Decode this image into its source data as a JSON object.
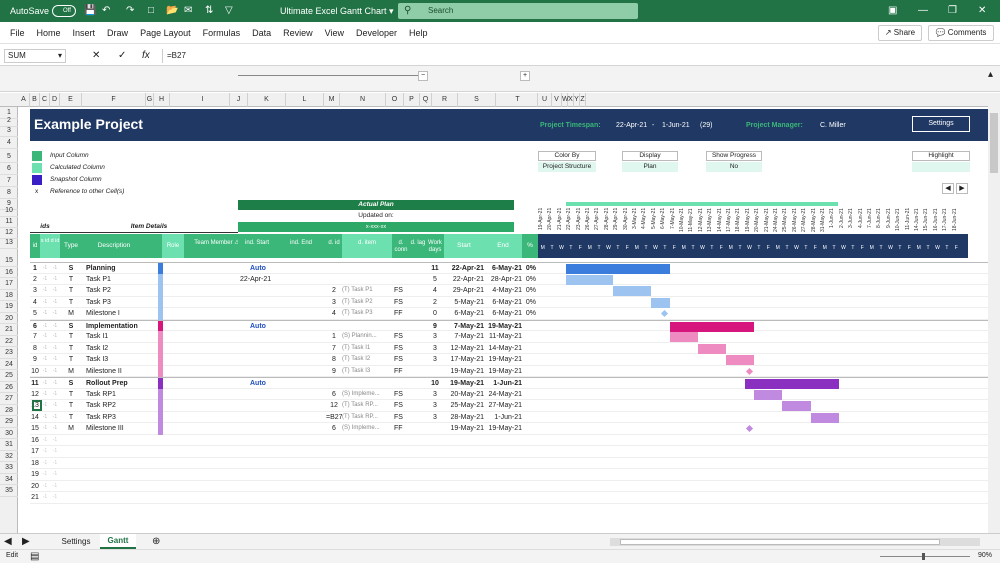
{
  "titlebar": {
    "autosave": "AutoSave",
    "autosave_state": "Off",
    "doc_title": "Ultimate Excel Gantt Chart",
    "search_placeholder": "Search"
  },
  "menu": [
    "File",
    "Home",
    "Insert",
    "Draw",
    "Page Layout",
    "Formulas",
    "Data",
    "Review",
    "View",
    "Developer",
    "Help"
  ],
  "share": "Share",
  "comments": "Comments",
  "formula": {
    "namebox": "SUM",
    "content": "=B27"
  },
  "columns": [
    "A",
    "B",
    "C",
    "D",
    "E",
    "F",
    "G",
    "H",
    "I",
    "J",
    "K",
    "L",
    "M",
    "N",
    "O",
    "P",
    "Q",
    "R",
    "S",
    "T",
    "U",
    "V",
    "W",
    "X",
    "Y",
    "Z"
  ],
  "header": {
    "project_title": "Example Project",
    "timespan_label": "Project Timespan:",
    "timespan_start": "22-Apr-21",
    "timespan_sep": "-",
    "timespan_end": "1-Jun-21",
    "timespan_days": "(29)",
    "pm_label": "Project Manager:",
    "pm_name": "C. Miller",
    "settings": "Settings"
  },
  "legend": [
    {
      "label": "Input Column",
      "color": "#3ab779"
    },
    {
      "label": "Calculated Column",
      "color": "#6de0b0"
    },
    {
      "label": "Snapshot Column",
      "color": "#3a1fc6"
    },
    {
      "label": "Reference to other Cell(s)",
      "symbol": "x"
    }
  ],
  "options": {
    "color_by_label": "Color By",
    "color_by_value": "Project Structure",
    "display_label": "Display",
    "display_value": "Plan",
    "progress_label": "Show Progress",
    "progress_value": "No",
    "highlight_label": "Highlight"
  },
  "table_headers": {
    "actual_plan": "Actual Plan",
    "updated_on": "Updated on:",
    "updated_val": "x-xxx-xx",
    "ids": "ids",
    "item_details": "Item Details",
    "id": "id",
    "s_id": "s id",
    "d_id": "d id",
    "type": "Type",
    "description": "Description",
    "role": "Role",
    "team_member": "Team Member",
    "ind_start": "ind. Start",
    "ind_end": "ind. End",
    "d_id2": "d. id",
    "d_item": "d. item",
    "d_conn": "d. conn",
    "d_lag": "d. lag",
    "work_days": "Work days",
    "start": "Start",
    "end": "End",
    "pct": "%"
  },
  "gantt_dates": [
    "19-Apr-21",
    "20-Apr-21",
    "21-Apr-21",
    "22-Apr-21",
    "23-Apr-21",
    "26-Apr-21",
    "27-Apr-21",
    "28-Apr-21",
    "29-Apr-21",
    "30-Apr-21",
    "3-May-21",
    "4-May-21",
    "5-May-21",
    "6-May-21",
    "7-May-21",
    "10-May-21",
    "11-May-21",
    "12-May-21",
    "13-May-21",
    "14-May-21",
    "17-May-21",
    "18-May-21",
    "19-May-21",
    "20-May-21",
    "21-May-21",
    "24-May-21",
    "25-May-21",
    "26-May-21",
    "27-May-21",
    "28-May-21",
    "31-May-21",
    "1-Jun-21",
    "2-Jun-21",
    "3-Jun-21",
    "4-Jun-21",
    "7-Jun-21",
    "8-Jun-21",
    "9-Jun-21",
    "10-Jun-21",
    "11-Jun-21",
    "14-Jun-21",
    "15-Jun-21",
    "16-Jun-21",
    "17-Jun-21",
    "18-Jun-21"
  ],
  "gantt_days": [
    "M",
    "T",
    "W",
    "T",
    "F"
  ],
  "rows": [
    {
      "n": "15",
      "id": "1",
      "type": "S",
      "desc": "Planning",
      "start_note": "Auto",
      "wd": "11",
      "start": "22-Apr-21",
      "end": "6-May-21",
      "pct": "0%",
      "bold": true,
      "color": "#3b7ddd"
    },
    {
      "n": "16",
      "id": "2",
      "type": "T",
      "desc": "Task P1",
      "ind_start": "22-Apr-21",
      "wd": "5",
      "start": "22-Apr-21",
      "end": "28-Apr-21",
      "pct": "0%",
      "color": "#9dc3f0"
    },
    {
      "n": "17",
      "id": "3",
      "type": "T",
      "desc": "Task P2",
      "did": "2",
      "ditem": "(T) Task P1",
      "dconn": "FS",
      "wd": "4",
      "start": "29-Apr-21",
      "end": "4-May-21",
      "pct": "0%",
      "color": "#9dc3f0"
    },
    {
      "n": "18",
      "id": "4",
      "type": "T",
      "desc": "Task P3",
      "did": "3",
      "ditem": "(T) Task P2",
      "dconn": "FS",
      "wd": "2",
      "start": "5-May-21",
      "end": "6-May-21",
      "pct": "0%",
      "color": "#9dc3f0"
    },
    {
      "n": "19",
      "id": "5",
      "type": "M",
      "desc": "Milestone I",
      "did": "4",
      "ditem": "(T) Task P3",
      "dconn": "FF",
      "wd": "0",
      "start": "6-May-21",
      "end": "6-May-21",
      "pct": "0%",
      "color": "#9dc3f0"
    },
    {
      "n": "20",
      "id": "6",
      "type": "S",
      "desc": "Implementation",
      "start_note": "Auto",
      "wd": "9",
      "start": "7-May-21",
      "end": "19-May-21",
      "bold": true,
      "color": "#d6157d"
    },
    {
      "n": "21",
      "id": "7",
      "type": "T",
      "desc": "Task I1",
      "did": "1",
      "ditem": "(S) Plannin...",
      "dconn": "FS",
      "wd": "3",
      "start": "7-May-21",
      "end": "11-May-21",
      "color": "#ee8bc0"
    },
    {
      "n": "22",
      "id": "8",
      "type": "T",
      "desc": "Task I2",
      "did": "7",
      "ditem": "(T) Task I1",
      "dconn": "FS",
      "wd": "3",
      "start": "12-May-21",
      "end": "14-May-21",
      "color": "#ee8bc0"
    },
    {
      "n": "23",
      "id": "9",
      "type": "T",
      "desc": "Task I3",
      "did": "8",
      "ditem": "(T) Task I2",
      "dconn": "FS",
      "wd": "3",
      "start": "17-May-21",
      "end": "19-May-21",
      "color": "#ee8bc0"
    },
    {
      "n": "24",
      "id": "10",
      "type": "M",
      "desc": "Milestone II",
      "did": "9",
      "ditem": "(T) Task I3",
      "dconn": "FF",
      "wd": "",
      "start": "19-May-21",
      "end": "19-May-21",
      "color": "#ee8bc0"
    },
    {
      "n": "25",
      "id": "11",
      "type": "S",
      "desc": "Rollout Prep",
      "start_note": "Auto",
      "wd": "10",
      "start": "19-May-21",
      "end": "1-Jun-21",
      "bold": true,
      "color": "#8a2fc0"
    },
    {
      "n": "26",
      "id": "12",
      "type": "T",
      "desc": "Task RP1",
      "did": "6",
      "ditem": "(S) Impleme...",
      "dconn": "FS",
      "wd": "3",
      "start": "20-May-21",
      "end": "24-May-21",
      "color": "#c08ae0"
    },
    {
      "n": "27",
      "id": "13",
      "type": "T",
      "desc": "Task RP2",
      "did": "12",
      "ditem": "(T) Task RP...",
      "dconn": "FS",
      "wd": "3",
      "start": "25-May-21",
      "end": "27-May-21",
      "color": "#c08ae0"
    },
    {
      "n": "28",
      "id": "14",
      "type": "T",
      "desc": "Task RP3",
      "did": "=B27",
      "ditem": "(T) Task RP...",
      "dconn": "FS",
      "wd": "3",
      "start": "28-May-21",
      "end": "1-Jun-21",
      "color": "#c08ae0"
    },
    {
      "n": "29",
      "id": "15",
      "type": "M",
      "desc": "Milestone III",
      "did": "6",
      "ditem": "(S) Impleme...",
      "dconn": "FF",
      "wd": "",
      "start": "19-May-21",
      "end": "19-May-21",
      "color": "#c08ae0"
    },
    {
      "n": "30",
      "id": "16"
    },
    {
      "n": "31",
      "id": "17"
    },
    {
      "n": "32",
      "id": "18"
    },
    {
      "n": "33",
      "id": "19"
    },
    {
      "n": "34",
      "id": "20"
    },
    {
      "n": "35",
      "id": "21"
    }
  ],
  "sheet_tabs": [
    "Settings",
    "Gantt"
  ],
  "status": {
    "mode": "Edit",
    "zoom": "90%"
  }
}
